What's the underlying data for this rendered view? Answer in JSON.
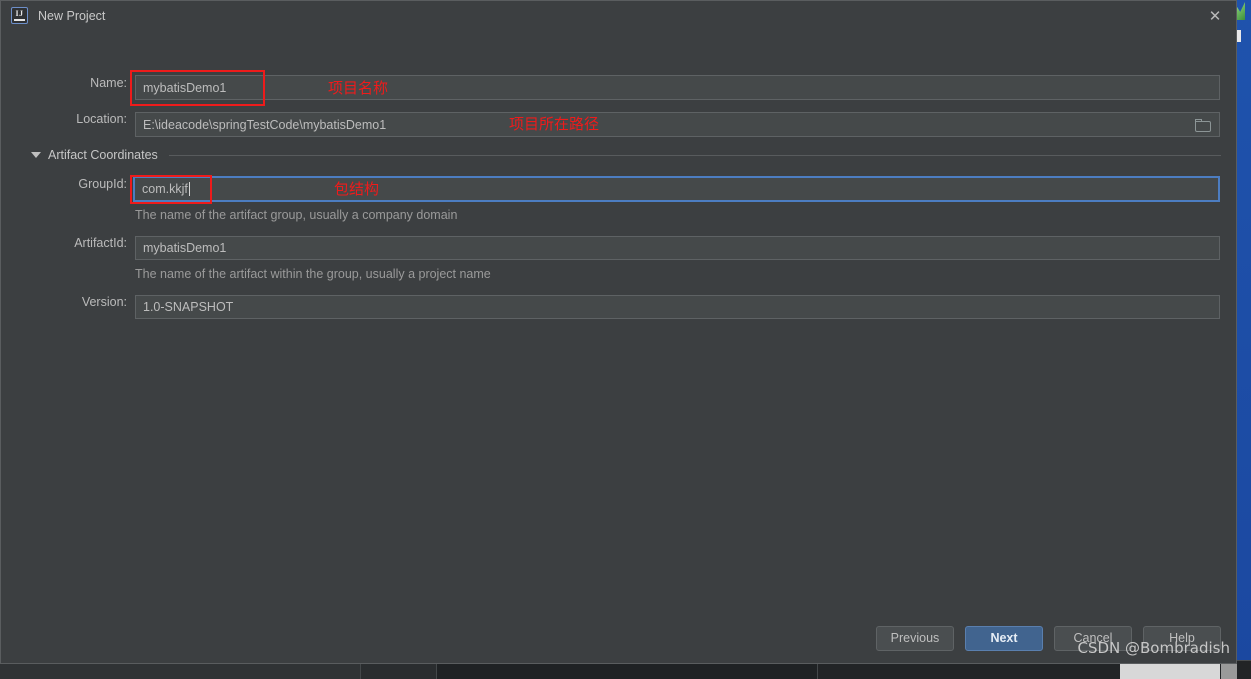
{
  "window": {
    "title": "New Project",
    "icon": "intellij-idea-icon",
    "close_label": "✕"
  },
  "form": {
    "name": {
      "label": "Name:",
      "value": "mybatisDemo1"
    },
    "location": {
      "label": "Location:",
      "value": "E:\\ideacode\\springTestCode\\mybatisDemo1",
      "browse_icon": "folder-icon"
    },
    "section": {
      "label": "Artifact Coordinates",
      "expanded": true
    },
    "group_id": {
      "label": "GroupId:",
      "value": "com.kkjf",
      "hint": "The name of the artifact group, usually a company domain",
      "focused": true
    },
    "artifact_id": {
      "label": "ArtifactId:",
      "value": "mybatisDemo1",
      "hint": "The name of the artifact within the group, usually a project name"
    },
    "version": {
      "label": "Version:",
      "value": "1.0-SNAPSHOT"
    }
  },
  "annotations": [
    {
      "text": "项目名称",
      "target": "name-field"
    },
    {
      "text": "项目所在路径",
      "target": "location-field"
    },
    {
      "text": "包结构",
      "target": "groupid-field"
    }
  ],
  "buttons": {
    "previous": "Previous",
    "next": "Next",
    "cancel": "Cancel",
    "help": "Help"
  },
  "watermark": "CSDN @Bombradish",
  "colors": {
    "dialog_background": "#3c3f41",
    "field_background": "#45494a",
    "accent_primary": "#41648f",
    "focus_border": "#4c7dc1",
    "annotation_red": "#ee1b1b",
    "desktop_blue": "#1d4ea8"
  }
}
